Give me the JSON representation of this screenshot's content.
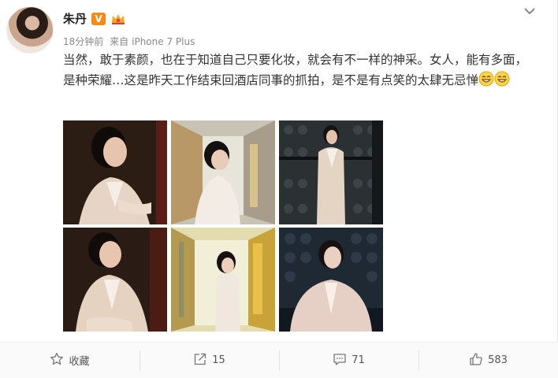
{
  "user": {
    "name": "朱丹",
    "verified_badge": "V",
    "badge_icon": "crown-icon"
  },
  "meta": {
    "time": "18分钟前",
    "source_prefix": "来自",
    "source": "iPhone 7 Plus"
  },
  "post": {
    "text": "当然，敢于素颜，也在于知道自己只要化妆，就会有不一样的神采。女人，能有多面，是种荣耀…这是昨天工作结束回酒店同事的抓拍，是不是有点笑的太肆无忌惮",
    "emoji": [
      "grin-emoji",
      "grin-emoji"
    ]
  },
  "photos": [
    {
      "name": "photo-1",
      "scene": "smiling woman in beige blazer, dark background"
    },
    {
      "name": "photo-2",
      "scene": "woman in hotel corridor"
    },
    {
      "name": "photo-3",
      "scene": "woman standing in front of padded wall"
    },
    {
      "name": "photo-4",
      "scene": "laughing woman in beige blazer"
    },
    {
      "name": "photo-5",
      "scene": "woman in bright hotel corridor"
    },
    {
      "name": "photo-6",
      "scene": "woman posing before padded wall"
    }
  ],
  "actions": {
    "favorite_label": "收藏",
    "repost_count": "15",
    "comment_count": "71",
    "like_count": "583"
  },
  "colors": {
    "badge_orange": "#f78a14",
    "text": "#333333",
    "meta_gray": "#888888",
    "action_bar_bg": "#fafafa"
  }
}
